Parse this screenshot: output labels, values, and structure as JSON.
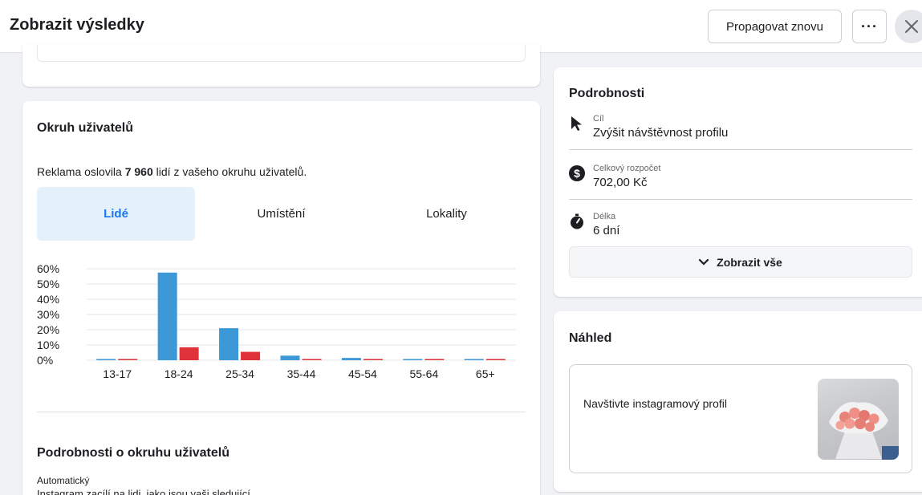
{
  "header": {
    "title": "Zobrazit výsledky",
    "promote_label": "Propagovat znovu",
    "more_label": "···"
  },
  "audience": {
    "title": "Okruh uživatelů",
    "reach_prefix": "Reklama oslovila ",
    "reach_count": "7 960",
    "reach_suffix": " lidí z vašeho okruhu uživatelů.",
    "tabs": [
      {
        "label": "Lidé",
        "active": true
      },
      {
        "label": "Umístění",
        "active": false
      },
      {
        "label": "Lokality",
        "active": false
      }
    ],
    "details_title": "Podrobnosti o okruhu uživatelů",
    "details_mode": "Automatický",
    "details_desc": "Instagram zacílí na lidi, jako jsou vaši sledující"
  },
  "chart_data": {
    "type": "bar",
    "categories": [
      "13-17",
      "18-24",
      "25-34",
      "35-44",
      "45-54",
      "55-64",
      "65+"
    ],
    "series": [
      {
        "values": [
          0.5,
          57.5,
          21,
          3,
          1.5,
          0.5,
          0.5
        ],
        "color": "#3d98d8"
      },
      {
        "values": [
          0.5,
          8.5,
          5.5,
          0.5,
          0.5,
          0.5,
          0.5
        ],
        "color": "#e03339"
      }
    ],
    "y_ticks": [
      "0%",
      "10%",
      "20%",
      "30%",
      "40%",
      "50%",
      "60%"
    ],
    "ylim": [
      0,
      60
    ],
    "grid": true
  },
  "details": {
    "title": "Podrobnosti",
    "rows": [
      {
        "icon": "cursor-icon",
        "label": "Cíl",
        "value": "Zvýšit návštěvnost profilu"
      },
      {
        "icon": "dollar-icon",
        "label": "Celkový rozpočet",
        "value": "702,00 Kč"
      },
      {
        "icon": "stopwatch-icon",
        "label": "Délka",
        "value": "6 dní"
      }
    ],
    "show_all_label": "Zobrazit vše"
  },
  "preview": {
    "title": "Náhled",
    "text": "Navštivte instagramový profil"
  }
}
